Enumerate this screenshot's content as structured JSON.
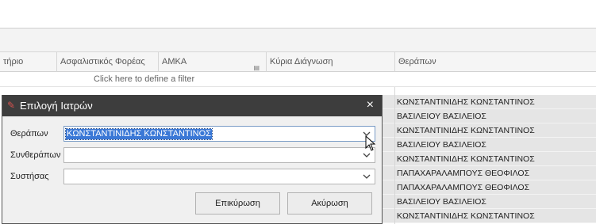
{
  "grid": {
    "columns": [
      {
        "label": "τήριο"
      },
      {
        "label": "Ασφαλιστικός Φορέας"
      },
      {
        "label": "ΑΜΚΑ"
      },
      {
        "label": "Κύρια Διάγνωση"
      },
      {
        "label": "Θεράπων"
      }
    ],
    "filter_prompt": "Click here to define a filter",
    "therapist_rows": [
      "ΚΩΝΣΤΑΝΤΙΝΙΔΗΣ ΚΩΝΣΤΑΝΤΙΝΟΣ",
      "ΒΑΣΙΛΕΙΟΥ ΒΑΣΙΛΕΙΟΣ",
      "ΚΩΝΣΤΑΝΤΙΝΙΔΗΣ ΚΩΝΣΤΑΝΤΙΝΟΣ",
      "ΒΑΣΙΛΕΙΟΥ ΒΑΣΙΛΕΙΟΣ",
      "ΚΩΝΣΤΑΝΤΙΝΙΔΗΣ ΚΩΝΣΤΑΝΤΙΝΟΣ",
      "ΠΑΠΑΧΑΡΑΛΑΜΠΟΥΣ ΘΕΟΦΙΛΟΣ",
      "ΠΑΠΑΧΑΡΑΛΑΜΠΟΥΣ ΘΕΟΦΙΛΟΣ",
      "ΒΑΣΙΛΕΙΟΥ ΒΑΣΙΛΕΙΟΣ",
      "ΚΩΝΣΤΑΝΤΙΝΙΔΗΣ ΚΩΝΣΤΑΝΤΙΝΟΣ"
    ]
  },
  "dialog": {
    "title": "Επιλογή Ιατρών",
    "close_glyph": "×",
    "fields": {
      "therapist": {
        "label": "Θεράπων",
        "value": "ΚΩΝΣΤΑΝΤΙΝΙΔΗΣ ΚΩΝΣΤΑΝΤΙΝΟΣ"
      },
      "co_therapist": {
        "label": "Συνθεράπων",
        "value": ""
      },
      "recommender": {
        "label": "Συστήσας",
        "value": ""
      }
    },
    "buttons": {
      "confirm": "Επικύρωση",
      "cancel": "Ακύρωση"
    }
  },
  "colors": {
    "title_bar": "#3d3d3d",
    "selection": "#3a78d6",
    "row_highlight": "#e5e5e5"
  }
}
